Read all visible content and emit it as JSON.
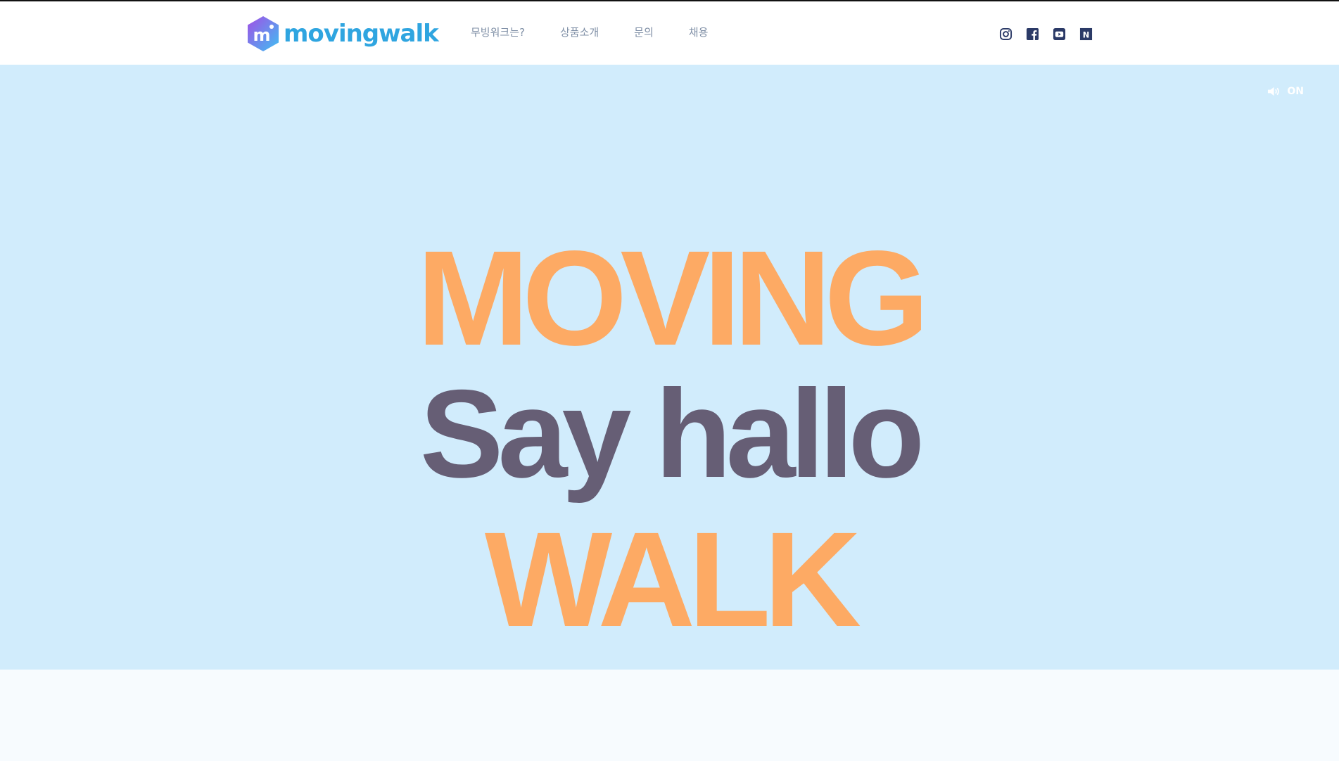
{
  "brand": {
    "name": "movingwalk",
    "colors": {
      "mark_start": "#9b59e8",
      "mark_end": "#4ab8f0",
      "text": "#2fa5e0"
    }
  },
  "nav": {
    "items": [
      {
        "label": "무빙워크는?"
      },
      {
        "label": "상품소개"
      },
      {
        "label": "문의"
      },
      {
        "label": "채용"
      }
    ]
  },
  "social": {
    "icons": [
      "instagram-icon",
      "facebook-icon",
      "youtube-icon",
      "naver-icon"
    ],
    "naver_letter": "N",
    "color": "#2b3a67"
  },
  "hero": {
    "background": "#d1ecfc",
    "sound": {
      "label": "ON",
      "icon": "speaker-icon"
    },
    "lines": [
      "MOVING",
      "Say hallo",
      "WALK"
    ],
    "colors": {
      "accent": "#fdaa64",
      "dark": "#665e75"
    }
  }
}
